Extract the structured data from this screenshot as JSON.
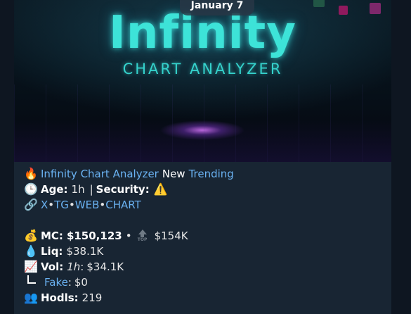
{
  "banner": {
    "date": "January 7",
    "logo_title": "Infinity",
    "logo_subtitle": "CHART ANALYZER"
  },
  "post": {
    "title_line": {
      "icon": "fire",
      "name": "Infinity Chart Analyzer",
      "tag_new": "New",
      "tag_trending": "Trending"
    },
    "age_line": {
      "icon": "clock",
      "age_label": "Age:",
      "age_value": "1h",
      "divider": "|",
      "security_label": "Security:",
      "security_icon": "warning"
    },
    "links_line": {
      "icon": "link",
      "links": [
        "X",
        "TG",
        "WEB",
        "CHART"
      ],
      "separator": "•"
    },
    "mc_line": {
      "icon": "money-bag",
      "label": "MC:",
      "value": "$150,123",
      "bullet": "•",
      "top_label": "TOP",
      "top_value": "$154K"
    },
    "liq_line": {
      "icon": "droplet",
      "label": "Liq:",
      "value": "$38.1K"
    },
    "vol_line": {
      "icon": "chart-increasing",
      "label": "Vol:",
      "period": "1h",
      "colon": ":",
      "value": "$34.1K"
    },
    "fake_line": {
      "icon": "corner",
      "label": "Fake",
      "colon": ":",
      "value": "$0"
    },
    "hodls_line": {
      "icon": "people",
      "label": "Hodls:",
      "value": "219"
    }
  },
  "colors": {
    "background": "#0e1621",
    "bubble": "#182533",
    "link": "#6ab2f2",
    "logo_cyan": "#3de3d8",
    "warning": "#f5c518"
  }
}
